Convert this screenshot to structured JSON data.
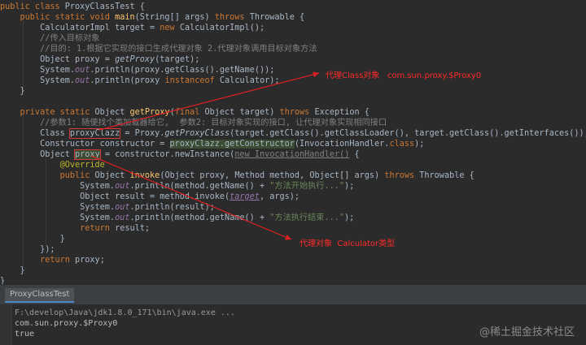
{
  "code": {
    "l1_a": "public class ",
    "l1_b": "ProxyClassTest",
    "l1_c": " {",
    "l2_a": "    public static void ",
    "l2_b": "main",
    "l2_c": "(String[] args) ",
    "l2_d": "throws",
    "l2_e": " Throwable {",
    "l3_a": "        CalculatorImpl target = ",
    "l3_b": "new",
    "l3_c": " CalculatorImpl();",
    "l4": "        //传入目标对象",
    "l5": "        //目的: 1.根据它实现的接口生成代理对象 2.代理对象调用目标对象方法",
    "l6_a": "        Object proxy = ",
    "l6_b": "getProxy",
    "l6_c": "(target);",
    "l7_a": "        System.",
    "l7_b": "out",
    "l7_c": ".println(proxy.getClass().getName());",
    "l8_a": "        System.",
    "l8_b": "out",
    "l8_c": ".println(proxy ",
    "l8_d": "instanceof",
    "l8_e": " Calculator);",
    "l9": "    }",
    "l11_a": "    private static ",
    "l11_b": "Object ",
    "l11_c": "getProxy",
    "l11_d": "(",
    "l11_e": "final",
    "l11_f": " Object target) ",
    "l11_g": "throws",
    "l11_h": " Exception {",
    "l12": "        //参数1: 随便找个类加载器给它,  参数2: 目标对象实现的接口, 让代理对象实现相同接口",
    "l13_a": "        Class ",
    "l13_b": "proxyClazz",
    "l13_c": " = Proxy.",
    "l13_d": "getProxyClass",
    "l13_e": "(target.getClass().getClassLoader(), target.getClass().getInterfaces());",
    "l14_a": "        Constructor constructor = ",
    "l14_b": "proxyClazz.getConstructor",
    "l14_c": "(InvocationHandler.",
    "l14_d": "class",
    "l14_e": ");",
    "l15_a": "        Object ",
    "l15_b": "proxy",
    "l15_c": " = constructor.newInstance(",
    "l15_d": "new InvocationHandler()",
    "l15_e": " {",
    "l16": "            @Override",
    "l17_a": "            ",
    "l17_b": "public",
    "l17_c": " Object ",
    "l17_d": "invoke",
    "l17_e": "(Object proxy, Method method, Object[] args) ",
    "l17_f": "throws",
    "l17_g": " Throwable {",
    "l18_a": "                System.",
    "l18_b": "out",
    "l18_c": ".println(method.getName() + ",
    "l18_d": "\"方法开始执行...\"",
    "l18_e": ");",
    "l19_a": "                Object result = method.invoke(",
    "l19_b": "target",
    "l19_c": ", args);",
    "l20_a": "                System.",
    "l20_b": "out",
    "l20_c": ".println(result);",
    "l21_a": "                System.",
    "l21_b": "out",
    "l21_c": ".println(method.getName() + ",
    "l21_d": "\"方法执行结束...\"",
    "l21_e": ");",
    "l22_a": "                ",
    "l22_b": "return",
    "l22_c": " result;",
    "l23": "            }",
    "l24": "        });",
    "l25_a": "        ",
    "l25_b": "return",
    "l25_c": " proxy;",
    "l26": "    }",
    "l27": "}"
  },
  "annotations": {
    "proxy_class": "代理Class对象   com.sun.proxy.$Proxy0",
    "proxy_object": "代理对象  Calculator类型"
  },
  "run_panel": {
    "tab_label": "ProxyClassTest",
    "command": "F:\\develop\\Java\\jdk1.8.0_171\\bin\\java.exe ...",
    "output": [
      "com.sun.proxy.$Proxy0",
      "true"
    ]
  },
  "watermark": "@稀土掘金技术社区",
  "colors": {
    "background": "#2b2b2b",
    "keyword": "#cc7832",
    "method": "#ffc66d",
    "string": "#6a8759",
    "comment": "#808080",
    "annotation_red": "#ff2a2a"
  }
}
